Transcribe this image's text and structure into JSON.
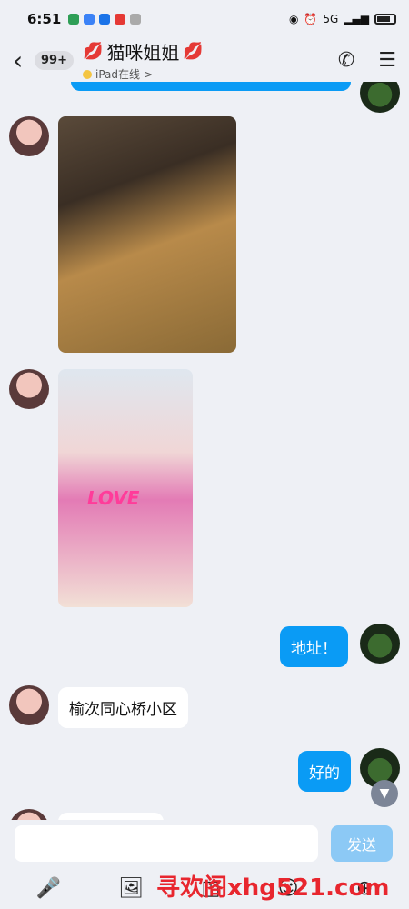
{
  "status_bar": {
    "time": "6:51",
    "network": "5G"
  },
  "header": {
    "back_icon": "‹",
    "unread_badge": "99+",
    "contact_name": "猫咪姐姐",
    "presence": "iPad在线",
    "presence_chevron": ">"
  },
  "messages": [
    {
      "type": "image",
      "sender": "contact",
      "image_desc": "photo"
    },
    {
      "type": "image",
      "sender": "contact",
      "image_desc": "photo",
      "overlay_text": "LOVE"
    },
    {
      "type": "text",
      "sender": "me",
      "text": "地址！"
    },
    {
      "type": "text",
      "sender": "contact",
      "text": "榆次同心桥小区"
    },
    {
      "type": "text",
      "sender": "me",
      "text": "好的"
    }
  ],
  "input": {
    "placeholder": "",
    "send_label": "发送"
  },
  "toolbar": [
    "mic-icon",
    "image-icon",
    "emoji-icon",
    "plus-icon"
  ],
  "watermark": "寻欢阁xhg521.com",
  "colors": {
    "bubble_out": "#0a9bf5",
    "send_button": "#8cc9f5",
    "background": "#eef0f5"
  }
}
